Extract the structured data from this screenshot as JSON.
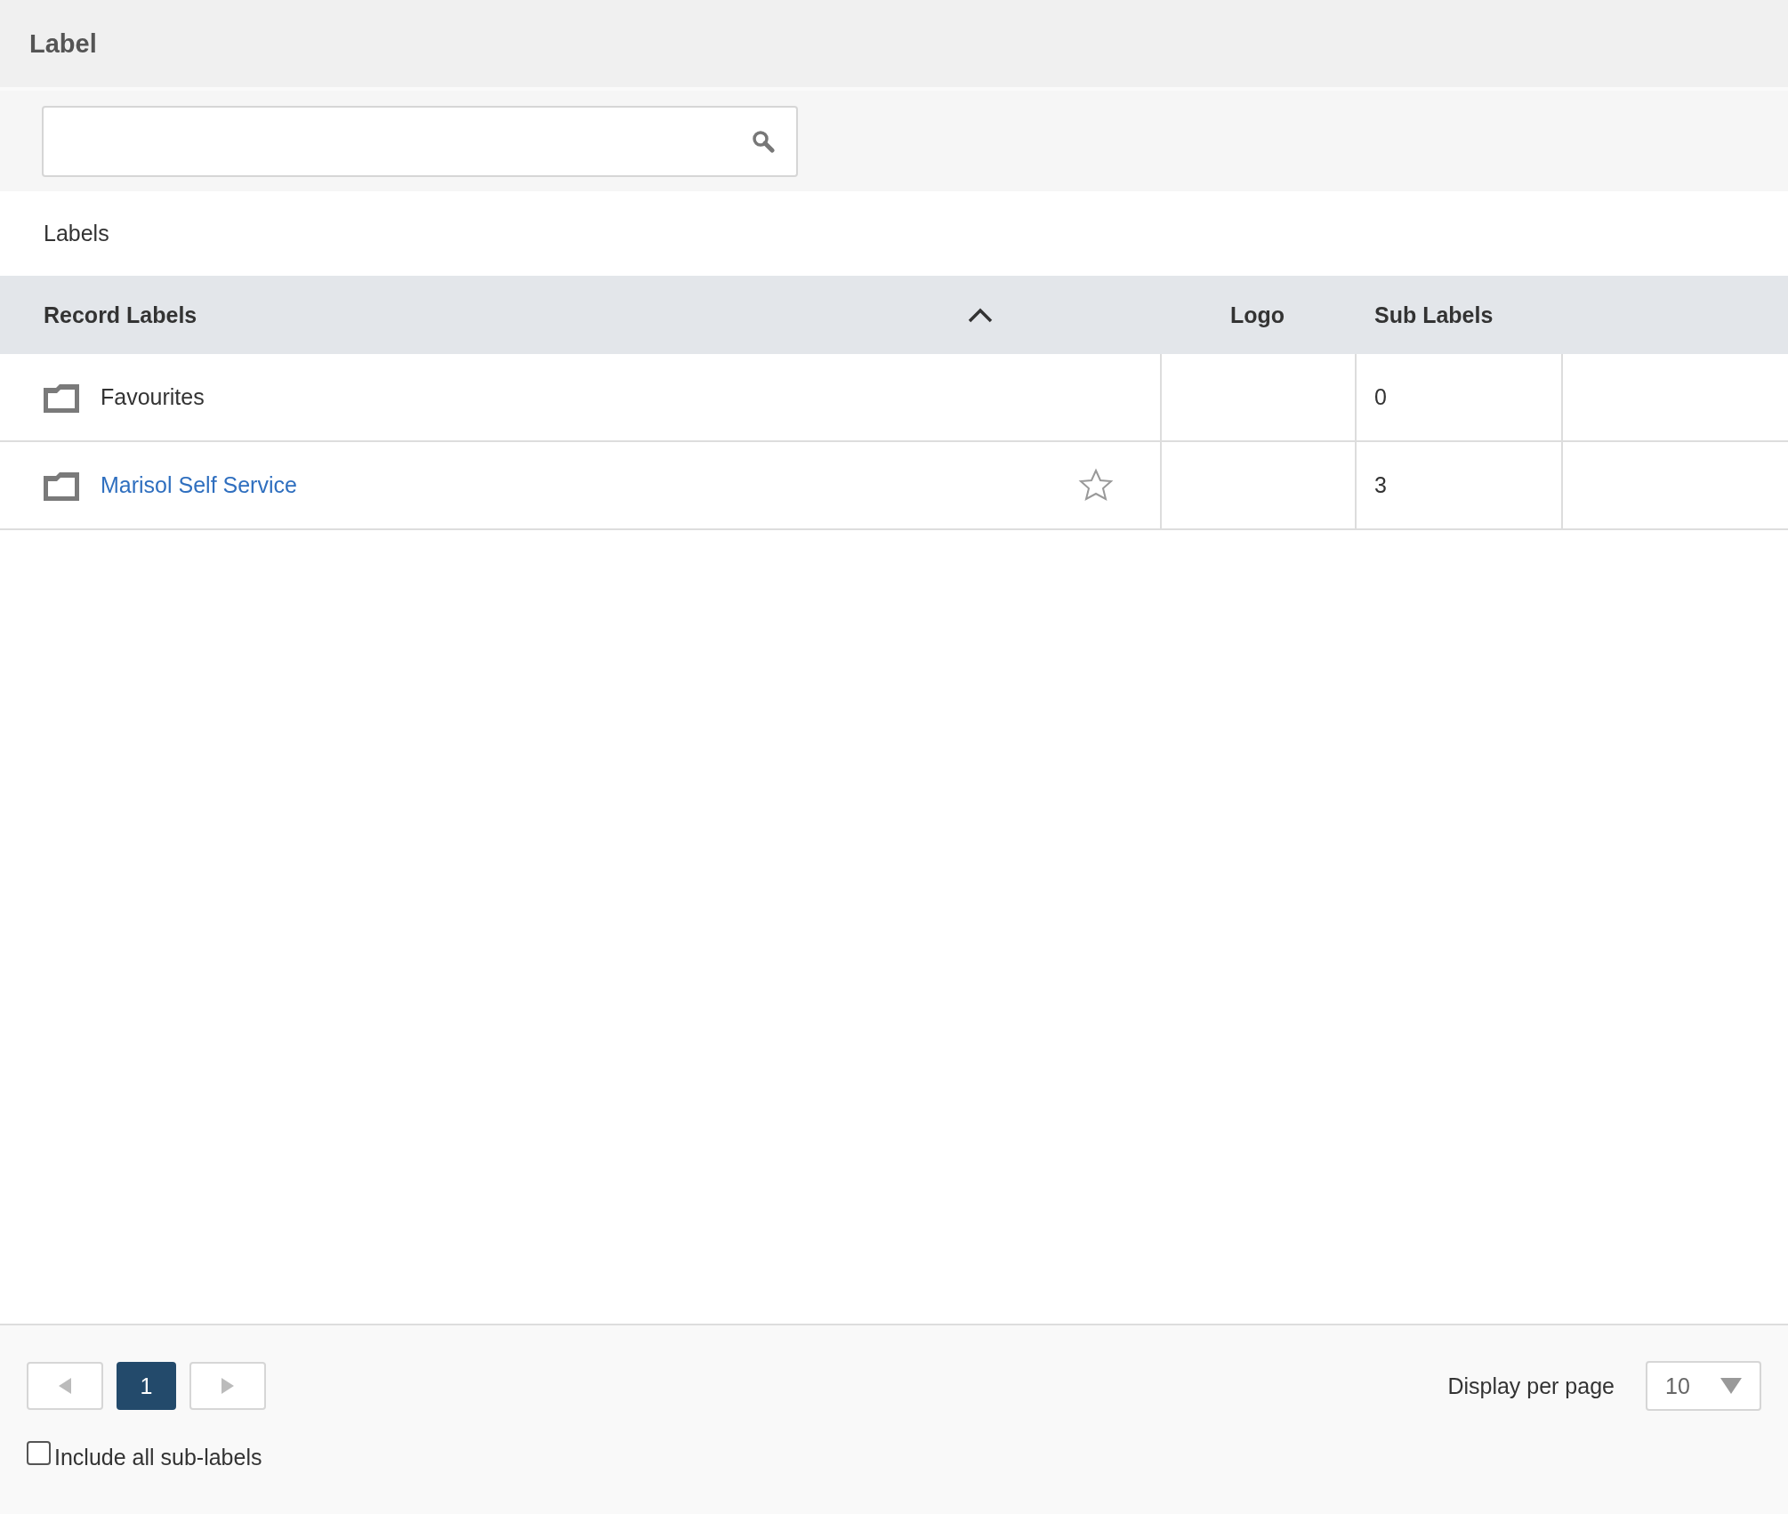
{
  "window": {
    "title": "Label"
  },
  "section_title": "Labels",
  "table": {
    "columns": [
      {
        "label": "Record Labels",
        "sorted_ascending": true
      },
      {
        "label": "Logo"
      },
      {
        "label": "Sub Labels"
      }
    ],
    "rows": [
      {
        "kind": "folder",
        "name": "Favourites",
        "sub_labels": "0"
      },
      {
        "kind": "label",
        "name": "Marisol Self Service",
        "starred": false,
        "sub_labels": "3"
      }
    ]
  },
  "pagination": {
    "pages": [
      {
        "label": "1",
        "selected": true
      }
    ],
    "per_page_label": "Display per page",
    "per_page": "10"
  },
  "include_sub_labels": {
    "label": "Include all sub-labels",
    "checked": false
  }
}
